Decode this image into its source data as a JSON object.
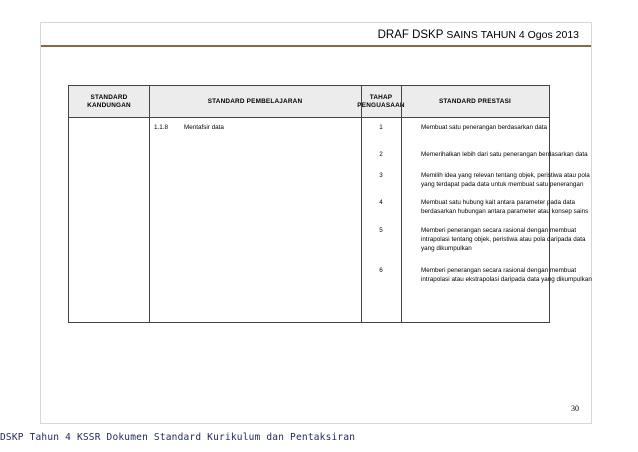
{
  "header": {
    "title_main": "DRAF DSKP",
    "title_rest": "SAINS TAHUN 4 Ogos 2013"
  },
  "table": {
    "headers": {
      "standard_kandungan": "STANDARD KANDUNGAN",
      "standard_pembelajaran": "STANDARD PEMBELAJARAN",
      "tahap_penguasaan": "TAHAP PENGUASAAN",
      "standard_prestasi": "STANDARD PRESTASI"
    },
    "sp_code": "1.1.8",
    "sp_text": "Mentafsir data",
    "rows": [
      {
        "level": "1",
        "lines": [
          "Membuat satu penerangan berdasarkan data"
        ]
      },
      {
        "level": "2",
        "lines": [
          "Memerihalkan lebih dari satu penerangan berdasarkan data"
        ]
      },
      {
        "level": "3",
        "lines": [
          "Memilih idea yang relevan tentang objek, peristiwa atau pola",
          "yang terdapat pada data untuk membuat  satu penerangan"
        ]
      },
      {
        "level": "4",
        "lines": [
          "Membuat satu hubung kait antara parameter pada data",
          "berdasarkan hubungan antara parameter atau konsep sains"
        ]
      },
      {
        "level": "5",
        "lines": [
          "Memberi penerangan secara rasional dengan membuat",
          "intrapolasi tentang objek, peristiwa atau pola daripada data",
          "yang dikumpulkan"
        ]
      },
      {
        "level": "6",
        "lines": [
          "Memberi penerangan secara rasional dengan membuat",
          "intrapolasi atau ekstrapolasi daripada data yang dikumpulkan"
        ]
      }
    ]
  },
  "page_number": "30",
  "footer_text": "DSKP Tahun 4 KSSR Dokumen Standard Kurikulum dan Pentaksiran"
}
